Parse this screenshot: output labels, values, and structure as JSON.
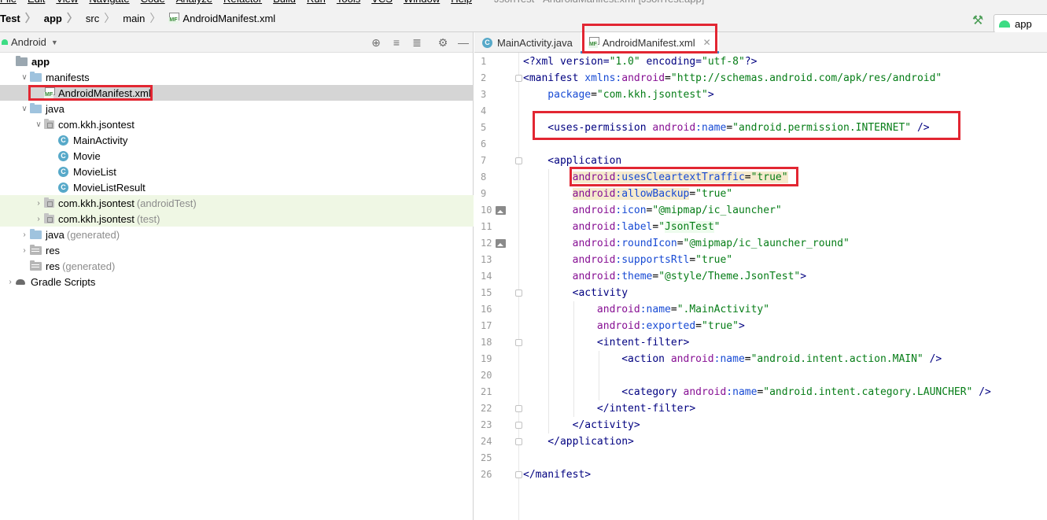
{
  "menubar": {
    "items": [
      "File",
      "Edit",
      "View",
      "Navigate",
      "Code",
      "Analyze",
      "Refactor",
      "Build",
      "Run",
      "Tools",
      "VCS",
      "Window",
      "Help"
    ],
    "window_title": "JsonTest - AndroidManifest.xml [JsonTest.app]"
  },
  "breadcrumb": {
    "project": "Test",
    "module": "app",
    "src": "src",
    "main": "main",
    "file": "AndroidManifest.xml"
  },
  "toolbar": {
    "run_config": "app",
    "build_icon": "hammer-icon"
  },
  "project_panel": {
    "view_mode": "Android",
    "tree": [
      {
        "label": "app",
        "bold": true,
        "icon": "folder-app",
        "indent": 0,
        "arrow": ""
      },
      {
        "label": "manifests",
        "icon": "folder",
        "indent": 1,
        "arrow": "v"
      },
      {
        "label": "AndroidManifest.xml",
        "icon": "manifest-file",
        "indent": 2,
        "arrow": "",
        "selected": true
      },
      {
        "label": "java",
        "icon": "folder",
        "indent": 1,
        "arrow": "v"
      },
      {
        "label": "com.kkh.jsontest",
        "icon": "package",
        "indent": 2,
        "arrow": "v"
      },
      {
        "label": "MainActivity",
        "icon": "class",
        "indent": 3,
        "arrow": ""
      },
      {
        "label": "Movie",
        "icon": "class",
        "indent": 3,
        "arrow": ""
      },
      {
        "label": "MovieList",
        "icon": "class",
        "indent": 3,
        "arrow": ""
      },
      {
        "label": "MovieListResult",
        "icon": "class",
        "indent": 3,
        "arrow": ""
      },
      {
        "label": "com.kkh.jsontest",
        "suffix": "(androidTest)",
        "icon": "package",
        "indent": 2,
        "arrow": ">",
        "test": true
      },
      {
        "label": "com.kkh.jsontest",
        "suffix": "(test)",
        "icon": "package",
        "indent": 2,
        "arrow": ">",
        "test": true
      },
      {
        "label": "java",
        "suffix": "(generated)",
        "icon": "folder-gen",
        "indent": 1,
        "arrow": ">"
      },
      {
        "label": "res",
        "icon": "folder-res",
        "indent": 1,
        "arrow": ">"
      },
      {
        "label": "res",
        "suffix": "(generated)",
        "icon": "folder-res",
        "indent": 1,
        "arrow": ""
      },
      {
        "label": "Gradle Scripts",
        "icon": "gradle",
        "indent": 0,
        "arrow": ">"
      }
    ]
  },
  "editor": {
    "tabs": [
      {
        "label": "MainActivity.java",
        "icon": "class-icon",
        "active": false
      },
      {
        "label": "AndroidManifest.xml",
        "icon": "manifest-icon",
        "active": true
      }
    ],
    "line_numbers": [
      "1",
      "2",
      "3",
      "4",
      "5",
      "6",
      "7",
      "8",
      "9",
      "10",
      "11",
      "12",
      "13",
      "14",
      "15",
      "16",
      "17",
      "18",
      "19",
      "20",
      "21",
      "22",
      "23",
      "24",
      "25",
      "26"
    ],
    "lines": [
      [
        {
          "t": "<?xml version=",
          "c": "tag"
        },
        {
          "t": "\"1.0\"",
          "c": "val"
        },
        {
          "t": " encoding=",
          "c": "tag"
        },
        {
          "t": "\"utf-8\"",
          "c": "val"
        },
        {
          "t": "?>",
          "c": "tag"
        }
      ],
      [
        {
          "t": "<manifest ",
          "c": "tag"
        },
        {
          "t": "xmlns:",
          "c": "attr"
        },
        {
          "t": "android",
          "c": "ns"
        },
        {
          "t": "=",
          "c": ""
        },
        {
          "t": "\"http://schemas.android.com/apk/res/android\"",
          "c": "val"
        }
      ],
      [
        {
          "t": "    package",
          "c": "attr"
        },
        {
          "t": "=",
          "c": ""
        },
        {
          "t": "\"com.kkh.jsontest\"",
          "c": "val"
        },
        {
          "t": ">",
          "c": "tag"
        }
      ],
      [],
      [
        {
          "t": "    <uses-permission ",
          "c": "tag"
        },
        {
          "t": "android",
          "c": "ns"
        },
        {
          "t": ":name",
          "c": "attr"
        },
        {
          "t": "=",
          "c": ""
        },
        {
          "t": "\"android.permission.INTERNET\"",
          "c": "val"
        },
        {
          "t": " />",
          "c": "tag"
        }
      ],
      [],
      [
        {
          "t": "    <application",
          "c": "tag"
        }
      ],
      [
        {
          "t": "        ",
          "c": ""
        },
        {
          "t": "android",
          "c": "ns hl"
        },
        {
          "t": ":usesCleartextTraffic",
          "c": "attr hl"
        },
        {
          "t": "=",
          "c": "hl"
        },
        {
          "t": "\"true\"",
          "c": "val hl"
        }
      ],
      [
        {
          "t": "        ",
          "c": ""
        },
        {
          "t": "android",
          "c": "ns hl"
        },
        {
          "t": ":allowBackup",
          "c": "attr hl"
        },
        {
          "t": "=",
          "c": ""
        },
        {
          "t": "\"true\"",
          "c": "val"
        }
      ],
      [
        {
          "t": "        android",
          "c": "ns"
        },
        {
          "t": ":icon",
          "c": "attr"
        },
        {
          "t": "=",
          "c": ""
        },
        {
          "t": "\"@mipmap/ic_launcher\"",
          "c": "val"
        }
      ],
      [
        {
          "t": "        android",
          "c": "ns"
        },
        {
          "t": ":label",
          "c": "attr"
        },
        {
          "t": "=",
          "c": ""
        },
        {
          "t": "\"",
          "c": "val"
        },
        {
          "t": "JsonTest",
          "c": "val hlw"
        },
        {
          "t": "\"",
          "c": "val"
        }
      ],
      [
        {
          "t": "        android",
          "c": "ns"
        },
        {
          "t": ":roundIcon",
          "c": "attr"
        },
        {
          "t": "=",
          "c": ""
        },
        {
          "t": "\"@mipmap/ic_launcher_round\"",
          "c": "val"
        }
      ],
      [
        {
          "t": "        android",
          "c": "ns"
        },
        {
          "t": ":supportsRtl",
          "c": "attr"
        },
        {
          "t": "=",
          "c": ""
        },
        {
          "t": "\"true\"",
          "c": "val"
        }
      ],
      [
        {
          "t": "        android",
          "c": "ns"
        },
        {
          "t": ":theme",
          "c": "attr"
        },
        {
          "t": "=",
          "c": ""
        },
        {
          "t": "\"@style/Theme.JsonTest\"",
          "c": "val"
        },
        {
          "t": ">",
          "c": "tag"
        }
      ],
      [
        {
          "t": "        <activity",
          "c": "tag"
        }
      ],
      [
        {
          "t": "            android",
          "c": "ns"
        },
        {
          "t": ":name",
          "c": "attr"
        },
        {
          "t": "=",
          "c": ""
        },
        {
          "t": "\".MainActivity\"",
          "c": "val"
        }
      ],
      [
        {
          "t": "            android",
          "c": "ns"
        },
        {
          "t": ":exported",
          "c": "attr"
        },
        {
          "t": "=",
          "c": ""
        },
        {
          "t": "\"true\"",
          "c": "val"
        },
        {
          "t": ">",
          "c": "tag"
        }
      ],
      [
        {
          "t": "            <intent-filter>",
          "c": "tag"
        }
      ],
      [
        {
          "t": "                <action ",
          "c": "tag"
        },
        {
          "t": "android",
          "c": "ns"
        },
        {
          "t": ":name",
          "c": "attr"
        },
        {
          "t": "=",
          "c": ""
        },
        {
          "t": "\"android.intent.action.MAIN\"",
          "c": "val"
        },
        {
          "t": " />",
          "c": "tag"
        }
      ],
      [],
      [
        {
          "t": "                <category ",
          "c": "tag"
        },
        {
          "t": "android",
          "c": "ns"
        },
        {
          "t": ":name",
          "c": "attr"
        },
        {
          "t": "=",
          "c": ""
        },
        {
          "t": "\"android.intent.category.LAUNCHER\"",
          "c": "val"
        },
        {
          "t": " />",
          "c": "tag"
        }
      ],
      [
        {
          "t": "            </intent-filter>",
          "c": "tag"
        }
      ],
      [
        {
          "t": "        </activity>",
          "c": "tag"
        }
      ],
      [
        {
          "t": "    </application>",
          "c": "tag"
        }
      ],
      [],
      [
        {
          "t": "</manifest>",
          "c": "tag"
        }
      ]
    ]
  },
  "colors": {
    "callout": "#e22632",
    "tab_underline": "#4083c9",
    "selection": "#d5d5d5"
  }
}
